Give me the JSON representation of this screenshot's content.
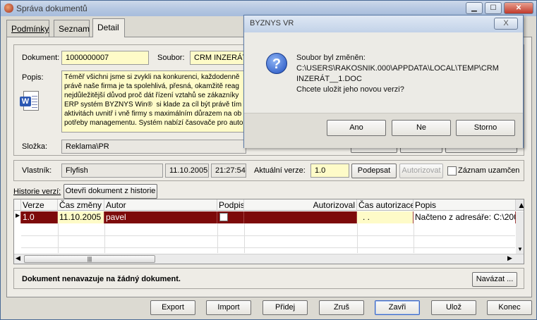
{
  "window": {
    "title": "Správa dokumentů"
  },
  "tabs": [
    {
      "label": "Podmínky"
    },
    {
      "label": "Seznam"
    },
    {
      "label": "Detail"
    }
  ],
  "document": {
    "document_label": "Dokument:",
    "document_value": "1000000007",
    "file_label": "Soubor:",
    "file_value": "CRM INZERÁT",
    "description_label": "Popis:",
    "description_lines": [
      "Téměř všichni jsme si zvykli na konkurenci, každodenně",
      "právě naše firma je ta spolehlivá, přesná, okamžitě reag",
      "nejdůležitější důvod proč dát řízení vztahů se zákazníky",
      "ERP systém BYZNYS Win®  si klade za cíl být právě tím",
      "aktivitách uvnitř i vně firmy s maximálním důrazem na ob",
      "potřeby managementu. Systém nabízí časovače pro autor"
    ],
    "folder_label": "Složka:",
    "folder_value": "Reklama\\PR",
    "owner_label": "Vlastník:",
    "owner_value": "Flyfish",
    "date_value": "11.10.2005",
    "time_value": "21:27:54",
    "current_version_label": "Aktuální verze:",
    "current_version_value": "1.0",
    "sign_button": "Podepsat",
    "authorize_button": "Autorizovat",
    "lock_label": "Záznam uzamčen"
  },
  "history": {
    "label": "Historie verzí:",
    "open_button": "Otevři dokument z historie",
    "columns": [
      "Verze",
      "Čas změny",
      "Autor",
      "Podpis",
      "Autorizoval",
      "Čas autorizace",
      "Popis"
    ],
    "rows": [
      {
        "version": "1.0",
        "changed": "11.10.2005",
        "author": "pavel",
        "authorized_by": "",
        "auth_time": ". .",
        "description": "Načteno z adresáře: C:\\200"
      }
    ]
  },
  "link": {
    "status_text": "Dokument nenavazuje na žádný dokument.",
    "link_button": "Navázat ..."
  },
  "footer_buttons": [
    "Export",
    "Import",
    "Přidej",
    "Zruš",
    "Zavři",
    "Ulož",
    "Konec"
  ],
  "dialog": {
    "title": "BYZNYS VR",
    "line1": "Soubor byl změněn:",
    "line2": "C:\\USERS\\RAKOSNIK.000\\APPDATA\\LOCAL\\TEMP\\CRM",
    "line3": "INZERÁT__1.DOC",
    "line4": "Chcete uložit jeho novou verzi?",
    "buttons": [
      "Ano",
      "Ne",
      "Storno"
    ],
    "close_glyph": "X"
  },
  "icons": {
    "app": "app-icon",
    "question": "question-icon",
    "word_document": "word-document-icon"
  },
  "colors": {
    "selected_row": "#7d0a0a",
    "field_yellow": "#fefbc8",
    "question_blue": "#1f4fbf"
  }
}
